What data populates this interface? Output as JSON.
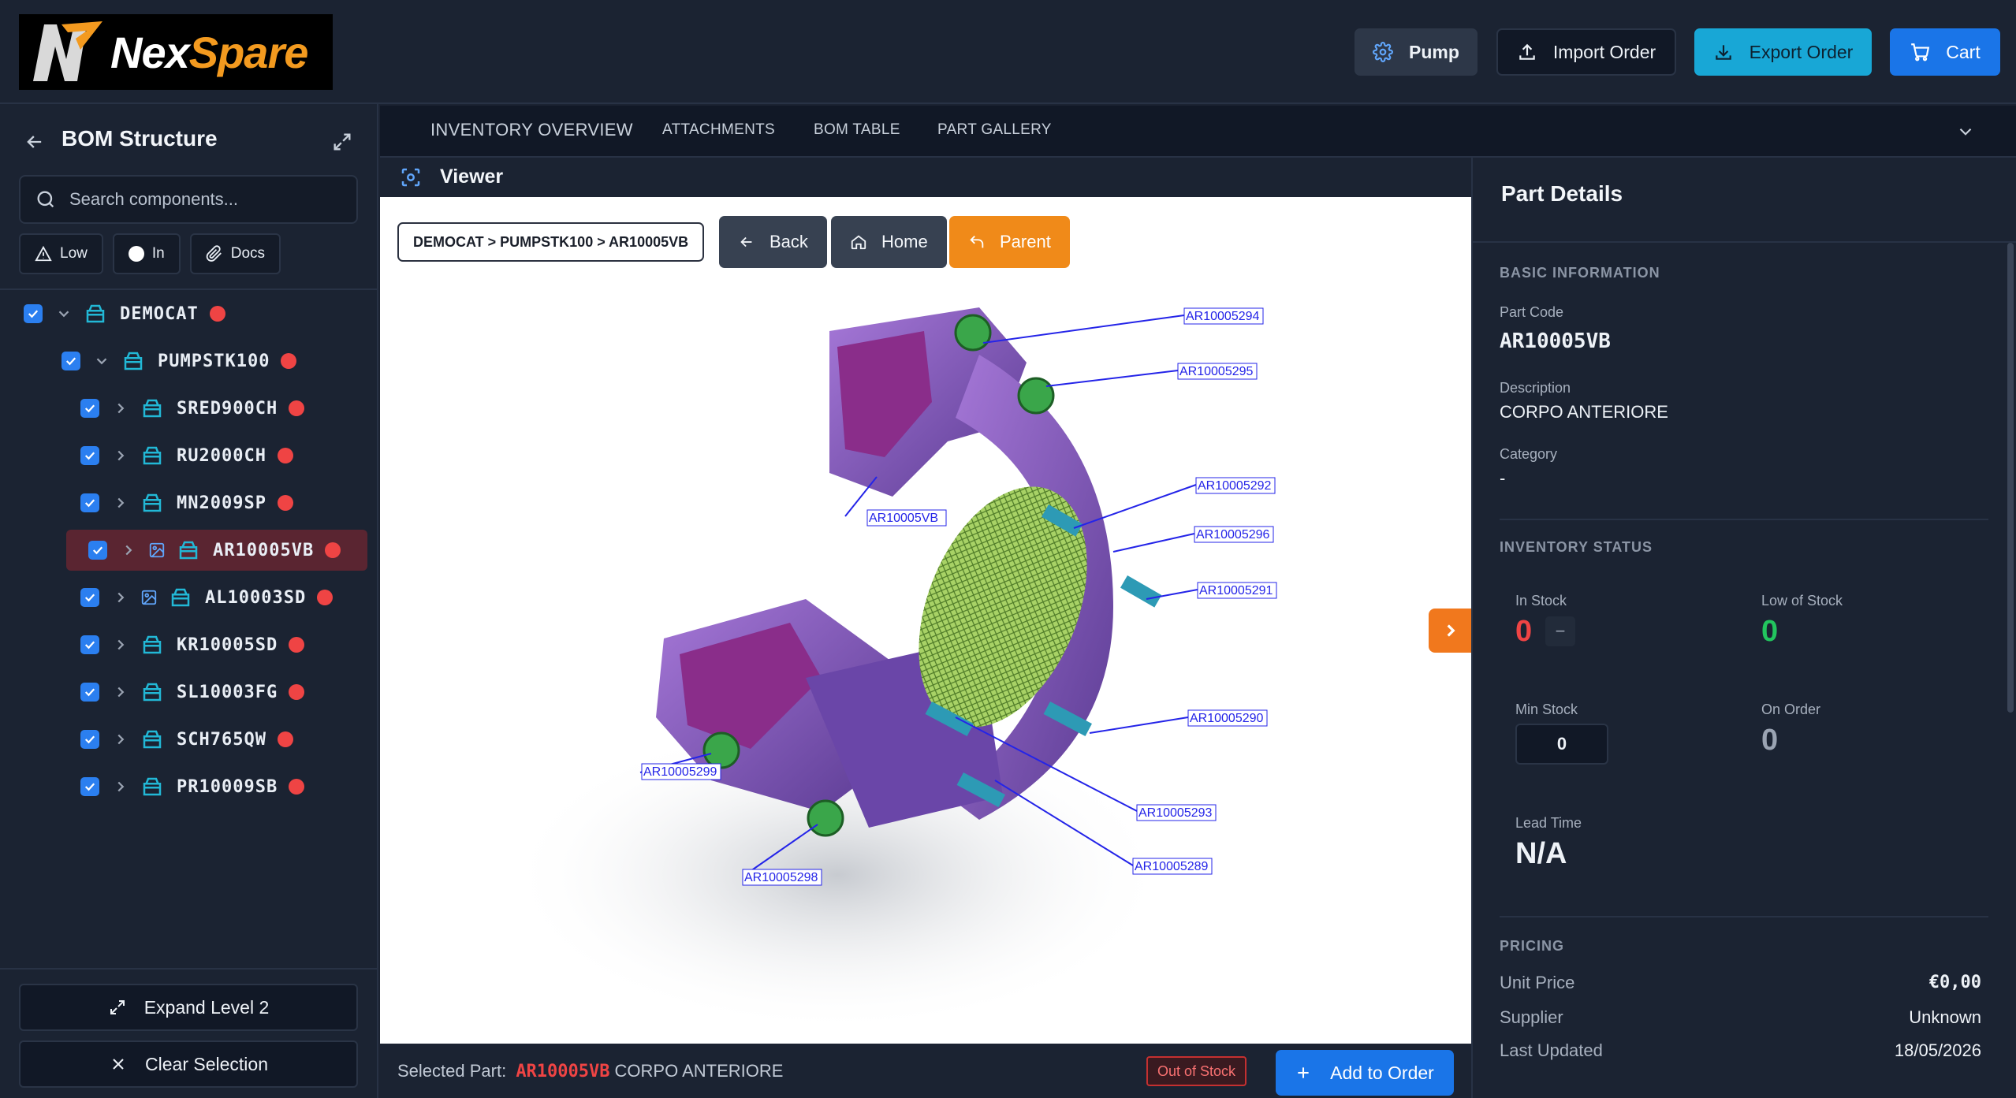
{
  "header": {
    "logo_nex": "Nex",
    "logo_spare": "Spare",
    "pump_label": "Pump",
    "import_label": "Import Order",
    "export_label": "Export Order",
    "cart_label": "Cart"
  },
  "sidebar": {
    "title": "BOM Structure",
    "search_placeholder": "Search components...",
    "filters": [
      "Low",
      "In",
      "Docs"
    ],
    "tree": [
      {
        "label": "DEMOCAT",
        "level": 0,
        "expanded": true
      },
      {
        "label": "PUMPSTK100",
        "level": 1,
        "expanded": true
      },
      {
        "label": "SRED900CH",
        "level": 2
      },
      {
        "label": "RU2000CH",
        "level": 2
      },
      {
        "label": "MN2009SP",
        "level": 2
      },
      {
        "label": "AR10005VB",
        "level": 2,
        "has_image": true,
        "selected": true
      },
      {
        "label": "AL10003SD",
        "level": 2,
        "has_image": true
      },
      {
        "label": "KR10005SD",
        "level": 2
      },
      {
        "label": "SL10003FG",
        "level": 2
      },
      {
        "label": "SCH765QW",
        "level": 2
      },
      {
        "label": "PR10009SB",
        "level": 2
      }
    ],
    "expand_label": "Expand Level 2",
    "clear_label": "Clear Selection"
  },
  "tabs": [
    "INVENTORY OVERVIEW",
    "ATTACHMENTS",
    "BOM TABLE",
    "PART GALLERY"
  ],
  "viewer": {
    "title": "Viewer",
    "breadcrumb": "DEMOCAT > PUMPSTK100 > AR10005VB",
    "back_label": "Back",
    "home_label": "Home",
    "parent_label": "Parent",
    "callouts": [
      "AR10005294",
      "AR10005295",
      "AR10005VB",
      "AR10005292",
      "AR10005296",
      "AR10005291",
      "AR10005290",
      "AR10005299",
      "AR10005293",
      "AR10005289",
      "AR10005298"
    ]
  },
  "selection": {
    "prefix": "Selected Part:",
    "code": "AR10005VB",
    "description": "CORPO ANTERIORE",
    "status": "Out of Stock",
    "add_label": "Add to Order"
  },
  "details": {
    "title": "Part Details",
    "basic_title": "BASIC INFORMATION",
    "part_code_label": "Part Code",
    "part_code": "AR10005VB",
    "description_label": "Description",
    "description": "CORPO ANTERIORE",
    "category_label": "Category",
    "category": "-",
    "inventory_title": "INVENTORY STATUS",
    "in_stock_label": "In Stock",
    "in_stock": "0",
    "minus": "−",
    "low_stock_label": "Low of Stock",
    "low_stock": "0",
    "min_stock_label": "Min Stock",
    "min_stock": "0",
    "on_order_label": "On Order",
    "on_order": "0",
    "lead_time_label": "Lead Time",
    "lead_time": "N/A",
    "pricing_title": "PRICING",
    "unit_price_label": "Unit Price",
    "unit_price": "€0,00",
    "supplier_label": "Supplier",
    "supplier": "Unknown",
    "updated_label": "Last Updated",
    "updated": "18/05/2026"
  },
  "colors": {
    "accent_blue": "#1a75e8",
    "accent_cyan": "#18a7d6",
    "accent_orange": "#f08a19",
    "status_red": "#ef4444",
    "status_green": "#22c55e"
  }
}
